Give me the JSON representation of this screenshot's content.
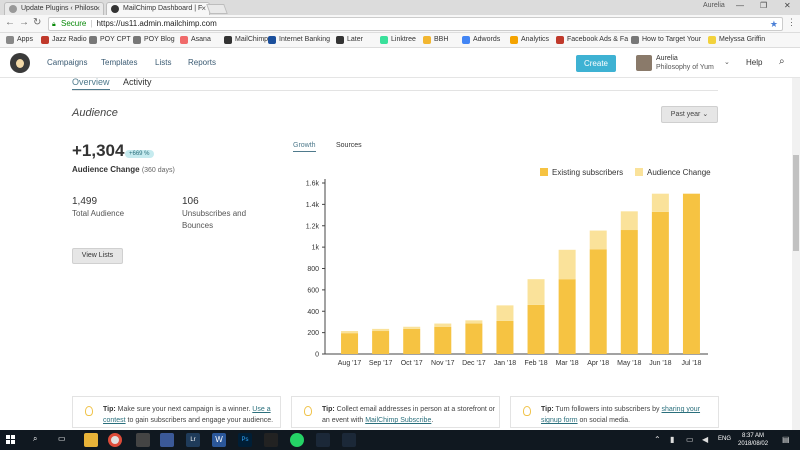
{
  "browser": {
    "tabs": [
      {
        "label": "Update Plugins ‹ Philoso",
        "active": false
      },
      {
        "label": "MailChimp Dashboard | F",
        "active": true
      }
    ],
    "user": "Aurelia",
    "secure_label": "Secure",
    "url": "https://us11.admin.mailchimp.com",
    "bookmarks": [
      {
        "label": "Apps",
        "color": "#888888"
      },
      {
        "label": "Jazz Radio",
        "color": "#c0392b"
      },
      {
        "label": "POY CPT",
        "color": "#777777"
      },
      {
        "label": "POY Blog",
        "color": "#777777"
      },
      {
        "label": "Asana",
        "color": "#f06a6a"
      },
      {
        "label": "MailChimp",
        "color": "#333333"
      },
      {
        "label": "Internet Banking",
        "color": "#1b4f9c"
      },
      {
        "label": "Later",
        "color": "#333333"
      },
      {
        "label": "Linktree",
        "color": "#39e09b"
      },
      {
        "label": "BBH",
        "color": "#f2b630"
      },
      {
        "label": "Adwords",
        "color": "#4285f4"
      },
      {
        "label": "Analytics",
        "color": "#f4a300"
      },
      {
        "label": "Facebook Ads & Fa",
        "color": "#c0392b"
      },
      {
        "label": "How to Target Your",
        "color": "#777777"
      },
      {
        "label": "Melyssa Griffin",
        "color": "#f2d23c"
      }
    ]
  },
  "header": {
    "nav": [
      "Campaigns",
      "Templates",
      "Lists",
      "Reports"
    ],
    "create_label": "Create",
    "account_name": "Aurelia",
    "account_org": "Philosophy of Yum",
    "help_label": "Help"
  },
  "subtabs": [
    "Overview",
    "Activity"
  ],
  "audience": {
    "title": "Audience",
    "range_label": "Past year",
    "change_value": "+1,304",
    "change_pct": "+669 %",
    "change_label": "Audience Change",
    "change_period": "(360 days)",
    "total_value": "1,499",
    "total_label": "Total Audience",
    "unsub_value": "106",
    "unsub_label": "Unsubscribes and Bounces",
    "view_lists_label": "View Lists"
  },
  "chart_tabs": [
    "Growth",
    "Sources"
  ],
  "chart_data": {
    "type": "bar",
    "stacked": true,
    "categories": [
      "Aug '17",
      "Sep '17",
      "Oct '17",
      "Nov '17",
      "Dec '17",
      "Jan '18",
      "Feb '18",
      "Mar '18",
      "Apr '18",
      "May '18",
      "Jun '18",
      "Jul '18"
    ],
    "series": [
      {
        "name": "Existing subscribers",
        "color": "#f6c342",
        "values": [
          195,
          215,
          235,
          255,
          285,
          310,
          460,
          700,
          980,
          1160,
          1330,
          1500
        ]
      },
      {
        "name": "Audience Change",
        "color": "#fae29a",
        "values": [
          20,
          20,
          20,
          30,
          30,
          145,
          240,
          275,
          175,
          175,
          170,
          0
        ]
      }
    ],
    "yticks": [
      "0",
      "200",
      "400",
      "600",
      "800",
      "1k",
      "1.2k",
      "1.4k",
      "1.6k"
    ],
    "ylim": [
      0,
      1600
    ],
    "legend": "top-right",
    "grid": false
  },
  "tips": [
    {
      "prefix": "Tip:",
      "text1": "Make sure your next campaign is a winner.",
      "link": "Use a contest",
      "text2": "to gain subscribers and engage your audience."
    },
    {
      "prefix": "Tip:",
      "text1": "Collect email addresses in person at a storefront or an event with",
      "link": "MailChimp Subscribe",
      "text2": "."
    },
    {
      "prefix": "Tip:",
      "text1": "Turn followers into subscribers by",
      "link": "sharing your signup form",
      "text2": "on social media."
    }
  ],
  "taskbar": {
    "lang": "ENG",
    "time": "8:37 AM",
    "date": "2018/08/02"
  }
}
